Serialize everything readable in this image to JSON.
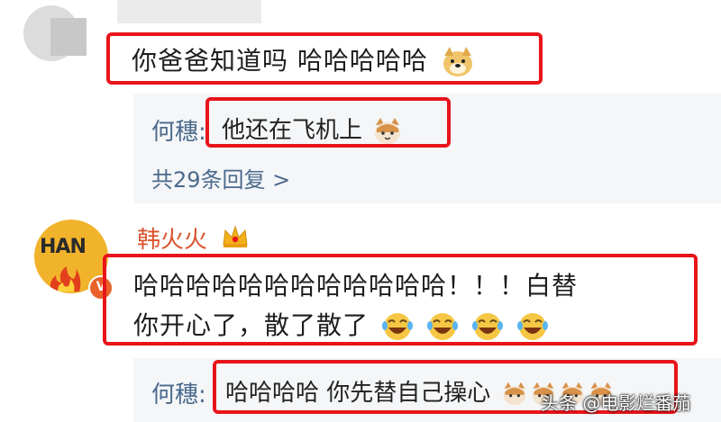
{
  "comment1": {
    "text": "你爸爸知道吗 哈哈哈哈哈"
  },
  "reply1": {
    "author": "何穗:",
    "text": "他还在飞机上",
    "count": "共29条回复 >"
  },
  "comment2": {
    "user": "韩火火",
    "avatar_text": "HAN",
    "line1": "哈哈哈哈哈哈哈哈哈哈哈哈！！！白替",
    "line2": "你开心了，散了散了"
  },
  "reply2": {
    "author": "何穗:",
    "text": "哈哈哈哈 你先替自己操心"
  },
  "watermark": "头条 @电影烂番茄",
  "colors": {
    "highlight": "#e8141a",
    "author_link": "#4b6a8c",
    "user_name": "#d9532c"
  },
  "icons": [
    "doge-emoji",
    "cat-emoji",
    "laugh-cry-emoji",
    "crown-icon",
    "verified-badge-icon"
  ]
}
